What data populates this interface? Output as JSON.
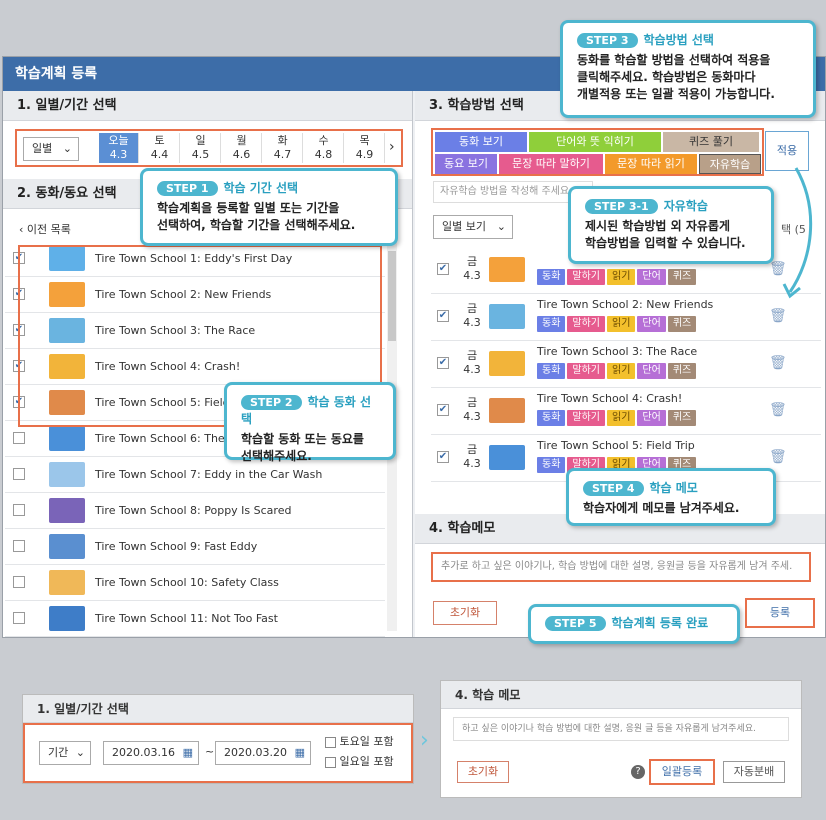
{
  "window": {
    "title": "학습계획 등록"
  },
  "sec1": {
    "header": "1. 일별/기간 선택",
    "mode": "일별",
    "days": [
      {
        "name": "오늘",
        "date": "4.3"
      },
      {
        "name": "토",
        "date": "4.4"
      },
      {
        "name": "일",
        "date": "4.5"
      },
      {
        "name": "월",
        "date": "4.6"
      },
      {
        "name": "화",
        "date": "4.7"
      },
      {
        "name": "수",
        "date": "4.8"
      },
      {
        "name": "목",
        "date": "4.9"
      }
    ]
  },
  "sec2": {
    "header": "2. 동화/동요 선택",
    "back": "이전 목록",
    "videos": [
      {
        "title": "Tire Town School 1: Eddy's First Day",
        "checked": true
      },
      {
        "title": "Tire Town School 2: New Friends",
        "checked": true
      },
      {
        "title": "Tire Town School 3: The Race",
        "checked": true
      },
      {
        "title": "Tire Town School 4: Crash!",
        "checked": true
      },
      {
        "title": "Tire Town School 5: Field",
        "checked": true
      },
      {
        "title": "Tire Town School 6: The C",
        "checked": false
      },
      {
        "title": "Tire Town School 7: Eddy in the Car Wash",
        "checked": false
      },
      {
        "title": "Tire Town School 8: Poppy Is Scared",
        "checked": false
      },
      {
        "title": "Tire Town School 9: Fast Eddy",
        "checked": false
      },
      {
        "title": "Tire Town School 10: Safety Class",
        "checked": false
      },
      {
        "title": "Tire Town School 11: Not Too Fast",
        "checked": false
      }
    ]
  },
  "sec3": {
    "header": "3. 학습방법 선택",
    "methods_row1": [
      "동화 보기",
      "단어와 뜻 익히기",
      "퀴즈 풀기"
    ],
    "methods_row2": [
      "동요 보기",
      "문장 따라 말하기",
      "문장 따라 읽기",
      "자유학습"
    ],
    "apply": "적용",
    "free_placeholder": "자유학습 방법을 작성해 주세요",
    "view_mode": "일별 보기",
    "col_partial": "택 (5",
    "rows": [
      {
        "day": "금",
        "date": "4.3",
        "title": ""
      },
      {
        "day": "금",
        "date": "4.3",
        "title": "Tire Town School 2: New Friends"
      },
      {
        "day": "금",
        "date": "4.3",
        "title": "Tire Town School 3: The Race"
      },
      {
        "day": "금",
        "date": "4.3",
        "title": "Tire Town School 4: Crash!"
      },
      {
        "day": "금",
        "date": "4.3",
        "title": "Tire Town School 5: Field Trip"
      }
    ],
    "tags": [
      "동화",
      "말하기",
      "읽기",
      "단어",
      "퀴즈"
    ]
  },
  "sec4": {
    "header": "4. 학습메모",
    "placeholder": "추가로 하고 싶은 이야기나, 학습 방법에 대한 설명, 응원글 등을 자유롭게 남겨 주세.",
    "reset": "초기화",
    "submit": "등록"
  },
  "steps": {
    "s1": {
      "pill": "STEP 1",
      "title": "학습 기간 선택",
      "text1": "학습계획을 등록할 일별 또는 기간을",
      "text2": "선택하여, 학습할 기간을 선택해주세요."
    },
    "s2": {
      "pill": "STEP 2",
      "title": "학습 동화 선택",
      "text1": "학습할 동화 또는 동요를",
      "text2": "선택해주세요."
    },
    "s3": {
      "pill": "STEP 3",
      "title": "학습방법 선택",
      "text1": "동화를 학습할 방법을 선택하여 적용을",
      "text2": "클릭해주세요. 학습방법은 동화마다",
      "text3": "개별적용 또는 일괄 적용이 가능합니다."
    },
    "s31": {
      "pill": "STEP 3-1",
      "title": "자유학습",
      "text1": "제시된 학습방법 외 자유롭게",
      "text2": "학습방법을 입력할 수 있습니다."
    },
    "s4": {
      "pill": "STEP 4",
      "title": "학습 메모",
      "text1": "학습자에게 메모를 남겨주세요."
    },
    "s5": {
      "pill": "STEP 5",
      "title": "학습계획 등록 완료"
    }
  },
  "bottom_left": {
    "header": "1. 일별/기간 선택",
    "mode": "기간",
    "start": "2020.03.16",
    "tilde": "~",
    "end": "2020.03.20",
    "sat": "토요일 포함",
    "sun": "일요일 포함"
  },
  "bottom_right": {
    "header": "4. 학습 메모",
    "placeholder": "하고 싶은 이야기나 학습 방법에 대한 설명, 응원 글 등을 자유롭게 남겨주세요.",
    "reset": "초기화",
    "help": "?",
    "bulk": "일괄등록",
    "auto": "자동분배"
  },
  "colors": {
    "accent": "#3d6da8",
    "highlight": "#e8704a",
    "callout": "#4db6cf"
  }
}
